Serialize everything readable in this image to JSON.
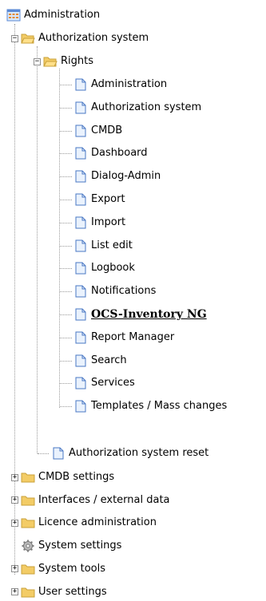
{
  "tree": {
    "root": {
      "label": "Administration",
      "icon": "admin-grid-icon"
    },
    "authorization_system": {
      "label": "Authorization system",
      "expander": "−",
      "icon": "folder-open-icon"
    },
    "rights": {
      "label": "Rights",
      "expander": "−",
      "icon": "folder-open-icon"
    },
    "rights_items": [
      {
        "label": "Administration"
      },
      {
        "label": "Authorization system"
      },
      {
        "label": "CMDB"
      },
      {
        "label": "Dashboard"
      },
      {
        "label": "Dialog-Admin"
      },
      {
        "label": "Export"
      },
      {
        "label": "Import"
      },
      {
        "label": "List edit"
      },
      {
        "label": "Logbook"
      },
      {
        "label": "Notifications"
      },
      {
        "label": "OCS-Inventory NG",
        "selected": true
      },
      {
        "label": "Report Manager"
      },
      {
        "label": "Search"
      },
      {
        "label": "Services"
      },
      {
        "label": "Templates / Mass changes"
      }
    ],
    "authorization_reset": {
      "label": "Authorization system reset",
      "icon": "document-icon"
    },
    "top_items": [
      {
        "label": "CMDB settings",
        "expander": "+",
        "icon": "folder-closed-icon"
      },
      {
        "label": "Interfaces / external data",
        "expander": "+",
        "icon": "folder-closed-icon"
      },
      {
        "label": "Licence administration",
        "expander": "+",
        "icon": "folder-closed-icon"
      },
      {
        "label": "System settings",
        "expander": "",
        "icon": "gear-icon"
      },
      {
        "label": "System tools",
        "expander": "+",
        "icon": "folder-closed-icon"
      },
      {
        "label": "User settings",
        "expander": "+",
        "icon": "folder-closed-icon"
      }
    ]
  },
  "colors": {
    "folder": "#f3cc66",
    "folder_dark": "#c9a13a",
    "doc_border": "#4a78c4",
    "doc_fill": "#eaf2fd",
    "line": "#9a9a9a"
  }
}
